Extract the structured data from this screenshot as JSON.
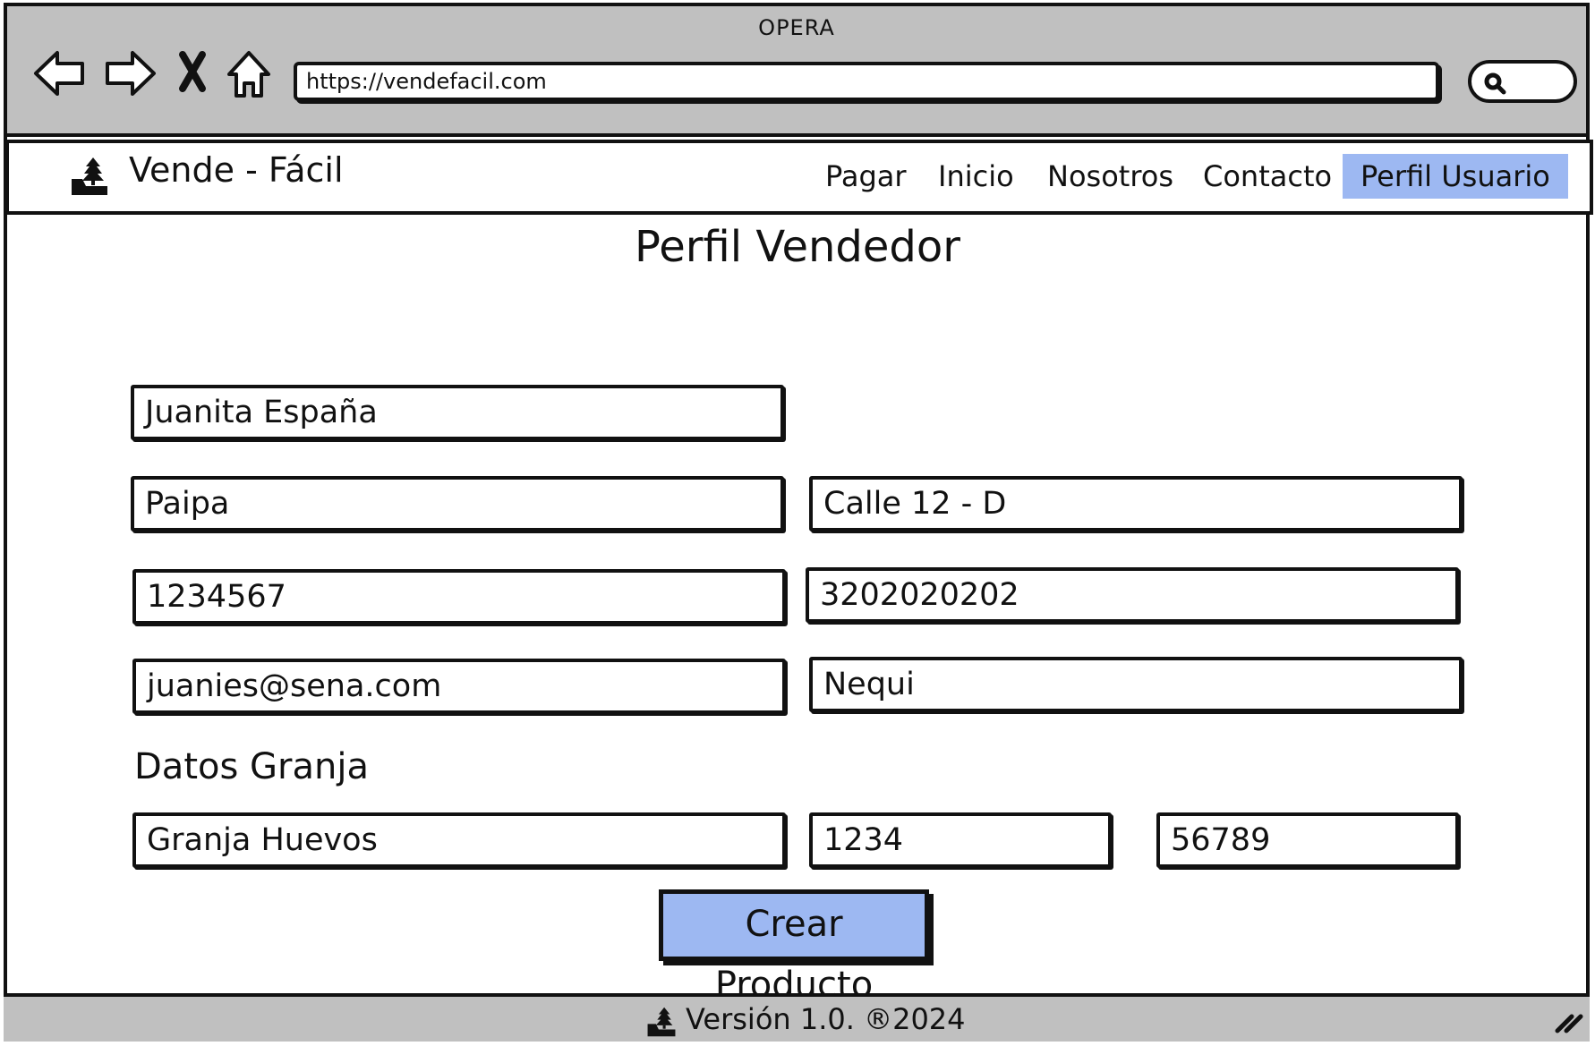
{
  "browser": {
    "title": "OPERA",
    "url": "https://vendefacil.com",
    "icons": [
      "back-arrow-icon",
      "forward-arrow-icon",
      "close-icon",
      "home-icon",
      "search-icon"
    ]
  },
  "header": {
    "site_title": "Vende - Fácil",
    "logo_icon": "landscape-tree-icon",
    "nav": [
      "Pagar",
      "Inicio",
      "Nosotros",
      "Contacto",
      "Perfil Usuario"
    ],
    "active_nav": "Perfil Usuario"
  },
  "main": {
    "title": "Perfil Vendedor",
    "fields": {
      "name": "Juanita España",
      "city": "Paipa",
      "address": "Calle 12 - D",
      "id_number": "1234567",
      "phone": "3202020202",
      "email": "juanies@sena.com",
      "payment": "Nequi"
    },
    "farm_section_label": "Datos Granja",
    "farm_fields": {
      "farm_name": "Granja Huevos",
      "farm_code_1": "1234",
      "farm_code_2": "56789"
    },
    "create_button_label": "Crear Producto"
  },
  "footer": {
    "text": "Versión 1.0.  ®2024"
  },
  "colors": {
    "chrome_gray": "#c0c0c0",
    "accent_blue": "#9db8f2",
    "outline": "#111111"
  }
}
